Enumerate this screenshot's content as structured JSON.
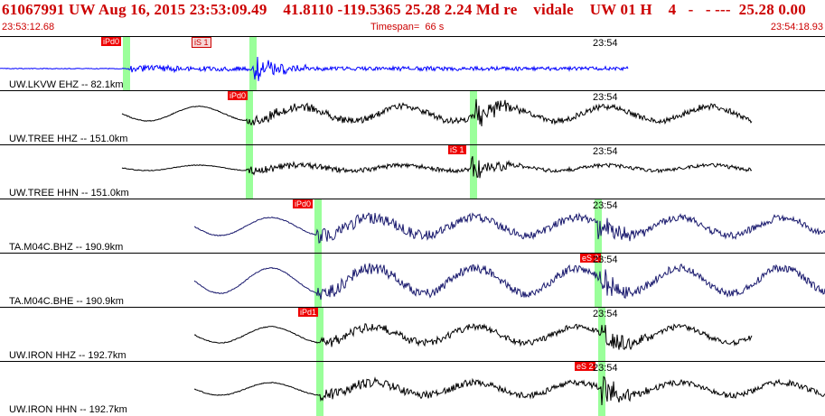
{
  "header": {
    "title": "61067991 UW Aug 16, 2015 23:53:09.49    41.8110 -119.5365 25.28 2.24 Md re    vidale    UW 01 H    4   -   - ---  25.28 0.00",
    "start_time": "23:53:12.68",
    "timespan": "Timespan=  66 s",
    "end_time": "23:54:18.93",
    "color": "#cc0000"
  },
  "panels": [
    {
      "station": "UW.LKVW EHZ -- 82.1km",
      "time_mark": "23:54",
      "picks": [
        "iPd0",
        "iS 1"
      ],
      "trace_color": "#0000ff"
    },
    {
      "station": "UW.TREE HHZ -- 151.0km",
      "time_mark": "23:54",
      "picks": [
        "iPd0"
      ],
      "trace_color": "#000000"
    },
    {
      "station": "UW.TREE HHN -- 151.0km",
      "time_mark": "23:54",
      "picks": [
        "iS 1"
      ],
      "trace_color": "#000000"
    },
    {
      "station": "TA.M04C.BHZ -- 190.9km",
      "time_mark": "23:54",
      "picks": [
        "iPd0"
      ],
      "trace_color": "#1a1a6e"
    },
    {
      "station": "TA.M04C.BHE -- 190.9km",
      "time_mark": "23:54",
      "picks": [
        "eS 2"
      ],
      "trace_color": "#1a1a6e"
    },
    {
      "station": "UW.IRON HHZ -- 192.7km",
      "time_mark": "23:54",
      "picks": [
        "iPd1"
      ],
      "trace_color": "#000000"
    },
    {
      "station": "UW.IRON HHN -- 192.7km",
      "time_mark": "23:54",
      "picks": [
        "eS 2"
      ],
      "trace_color": "#000000"
    }
  ]
}
